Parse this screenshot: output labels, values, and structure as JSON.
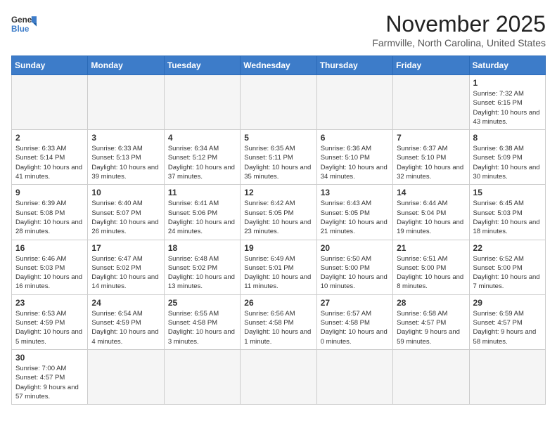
{
  "header": {
    "logo_general": "General",
    "logo_blue": "Blue",
    "month_title": "November 2025",
    "location": "Farmville, North Carolina, United States"
  },
  "weekdays": [
    "Sunday",
    "Monday",
    "Tuesday",
    "Wednesday",
    "Thursday",
    "Friday",
    "Saturday"
  ],
  "weeks": [
    [
      {
        "day": "",
        "info": ""
      },
      {
        "day": "",
        "info": ""
      },
      {
        "day": "",
        "info": ""
      },
      {
        "day": "",
        "info": ""
      },
      {
        "day": "",
        "info": ""
      },
      {
        "day": "",
        "info": ""
      },
      {
        "day": "1",
        "info": "Sunrise: 7:32 AM\nSunset: 6:15 PM\nDaylight: 10 hours and 43 minutes."
      }
    ],
    [
      {
        "day": "2",
        "info": "Sunrise: 6:33 AM\nSunset: 5:14 PM\nDaylight: 10 hours and 41 minutes."
      },
      {
        "day": "3",
        "info": "Sunrise: 6:33 AM\nSunset: 5:13 PM\nDaylight: 10 hours and 39 minutes."
      },
      {
        "day": "4",
        "info": "Sunrise: 6:34 AM\nSunset: 5:12 PM\nDaylight: 10 hours and 37 minutes."
      },
      {
        "day": "5",
        "info": "Sunrise: 6:35 AM\nSunset: 5:11 PM\nDaylight: 10 hours and 35 minutes."
      },
      {
        "day": "6",
        "info": "Sunrise: 6:36 AM\nSunset: 5:10 PM\nDaylight: 10 hours and 34 minutes."
      },
      {
        "day": "7",
        "info": "Sunrise: 6:37 AM\nSunset: 5:10 PM\nDaylight: 10 hours and 32 minutes."
      },
      {
        "day": "8",
        "info": "Sunrise: 6:38 AM\nSunset: 5:09 PM\nDaylight: 10 hours and 30 minutes."
      }
    ],
    [
      {
        "day": "9",
        "info": "Sunrise: 6:39 AM\nSunset: 5:08 PM\nDaylight: 10 hours and 28 minutes."
      },
      {
        "day": "10",
        "info": "Sunrise: 6:40 AM\nSunset: 5:07 PM\nDaylight: 10 hours and 26 minutes."
      },
      {
        "day": "11",
        "info": "Sunrise: 6:41 AM\nSunset: 5:06 PM\nDaylight: 10 hours and 24 minutes."
      },
      {
        "day": "12",
        "info": "Sunrise: 6:42 AM\nSunset: 5:05 PM\nDaylight: 10 hours and 23 minutes."
      },
      {
        "day": "13",
        "info": "Sunrise: 6:43 AM\nSunset: 5:05 PM\nDaylight: 10 hours and 21 minutes."
      },
      {
        "day": "14",
        "info": "Sunrise: 6:44 AM\nSunset: 5:04 PM\nDaylight: 10 hours and 19 minutes."
      },
      {
        "day": "15",
        "info": "Sunrise: 6:45 AM\nSunset: 5:03 PM\nDaylight: 10 hours and 18 minutes."
      }
    ],
    [
      {
        "day": "16",
        "info": "Sunrise: 6:46 AM\nSunset: 5:03 PM\nDaylight: 10 hours and 16 minutes."
      },
      {
        "day": "17",
        "info": "Sunrise: 6:47 AM\nSunset: 5:02 PM\nDaylight: 10 hours and 14 minutes."
      },
      {
        "day": "18",
        "info": "Sunrise: 6:48 AM\nSunset: 5:02 PM\nDaylight: 10 hours and 13 minutes."
      },
      {
        "day": "19",
        "info": "Sunrise: 6:49 AM\nSunset: 5:01 PM\nDaylight: 10 hours and 11 minutes."
      },
      {
        "day": "20",
        "info": "Sunrise: 6:50 AM\nSunset: 5:00 PM\nDaylight: 10 hours and 10 minutes."
      },
      {
        "day": "21",
        "info": "Sunrise: 6:51 AM\nSunset: 5:00 PM\nDaylight: 10 hours and 8 minutes."
      },
      {
        "day": "22",
        "info": "Sunrise: 6:52 AM\nSunset: 5:00 PM\nDaylight: 10 hours and 7 minutes."
      }
    ],
    [
      {
        "day": "23",
        "info": "Sunrise: 6:53 AM\nSunset: 4:59 PM\nDaylight: 10 hours and 5 minutes."
      },
      {
        "day": "24",
        "info": "Sunrise: 6:54 AM\nSunset: 4:59 PM\nDaylight: 10 hours and 4 minutes."
      },
      {
        "day": "25",
        "info": "Sunrise: 6:55 AM\nSunset: 4:58 PM\nDaylight: 10 hours and 3 minutes."
      },
      {
        "day": "26",
        "info": "Sunrise: 6:56 AM\nSunset: 4:58 PM\nDaylight: 10 hours and 1 minute."
      },
      {
        "day": "27",
        "info": "Sunrise: 6:57 AM\nSunset: 4:58 PM\nDaylight: 10 hours and 0 minutes."
      },
      {
        "day": "28",
        "info": "Sunrise: 6:58 AM\nSunset: 4:57 PM\nDaylight: 9 hours and 59 minutes."
      },
      {
        "day": "29",
        "info": "Sunrise: 6:59 AM\nSunset: 4:57 PM\nDaylight: 9 hours and 58 minutes."
      }
    ],
    [
      {
        "day": "30",
        "info": "Sunrise: 7:00 AM\nSunset: 4:57 PM\nDaylight: 9 hours and 57 minutes."
      },
      {
        "day": "",
        "info": ""
      },
      {
        "day": "",
        "info": ""
      },
      {
        "day": "",
        "info": ""
      },
      {
        "day": "",
        "info": ""
      },
      {
        "day": "",
        "info": ""
      },
      {
        "day": "",
        "info": ""
      }
    ]
  ]
}
